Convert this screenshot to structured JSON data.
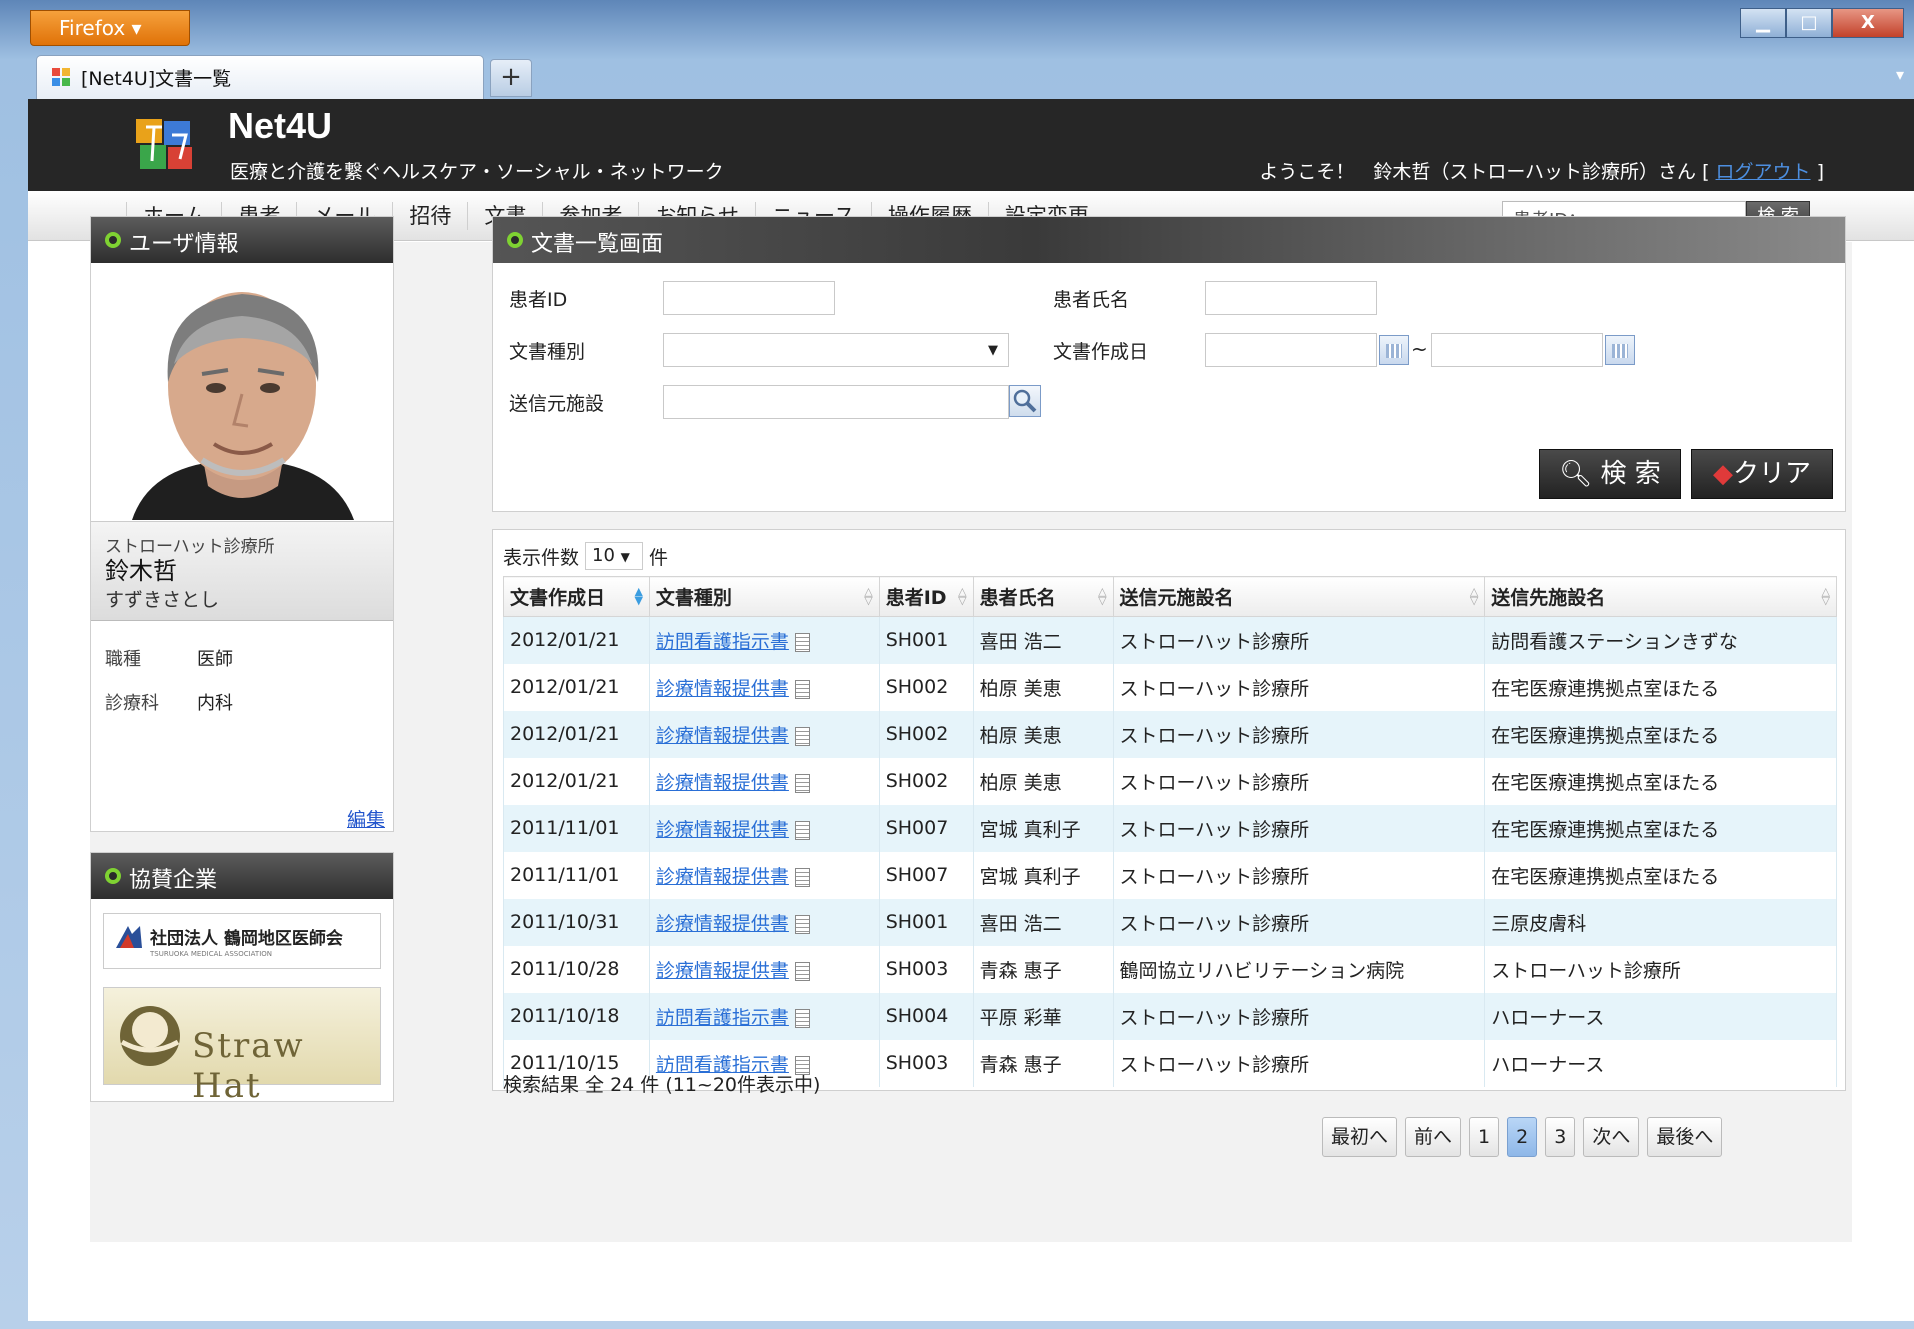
{
  "browser": {
    "menu_label": "Firefox ▾",
    "tab_title": "[Net4U]文書一覧",
    "new_tab": "+",
    "minimize": "▁",
    "maximize": "□",
    "close": "X",
    "tab_list": "▾"
  },
  "header": {
    "logo_name": "Net4U",
    "tagline": "医療と介護を繋ぐヘルスケア・ソーシャル・ネットワーク",
    "welcome_prefix": "ようこそ！　鈴木哲（ストローハット診療所）さん [ ",
    "logout": "ログアウト",
    "welcome_suffix": " ]"
  },
  "nav": {
    "items": [
      "ホーム",
      "患者",
      "メール",
      "招待",
      "文書",
      "参加者",
      "お知らせ",
      "ニュース",
      "操作履歴",
      "設定変更"
    ],
    "search_placeholder": "患者ID：",
    "search_button": "検 索"
  },
  "user_panel": {
    "title": "ユーザ情報",
    "org": "ストローハット診療所",
    "name": "鈴木哲",
    "kana": "すずきさとし",
    "attrs": [
      {
        "key": "職種",
        "value": "医師"
      },
      {
        "key": "診療科",
        "value": "内科"
      }
    ],
    "edit": "編集"
  },
  "sponsor_panel": {
    "title": "協賛企業",
    "sponsor1": "社団法人 鶴岡地区医師会",
    "sponsor1_sub": "TSURUOKA MEDICAL ASSOCIATION",
    "sponsor2": "Straw Hat"
  },
  "search_panel": {
    "title": "文書一覧画面",
    "patient_id_label": "患者ID",
    "patient_name_label": "患者氏名",
    "doc_type_label": "文書種別",
    "doc_date_label": "文書作成日",
    "date_sep": "~",
    "sender_label": "送信元施設",
    "search_button": "検 索",
    "clear_button": "クリア"
  },
  "results": {
    "page_size_label": "表示件数",
    "page_size_value": "10",
    "page_size_unit": "件",
    "columns": [
      "文書作成日",
      "文書種別",
      "患者ID",
      "患者氏名",
      "送信元施設名",
      "送信先施設名"
    ],
    "rows": [
      [
        "2012/01/21",
        "訪問看護指示書",
        "SH001",
        "喜田 浩二",
        "ストローハット診療所",
        "訪問看護ステーションきずな"
      ],
      [
        "2012/01/21",
        "診療情報提供書",
        "SH002",
        "柏原 美恵",
        "ストローハット診療所",
        "在宅医療連携拠点室ほたる"
      ],
      [
        "2012/01/21",
        "診療情報提供書",
        "SH002",
        "柏原 美恵",
        "ストローハット診療所",
        "在宅医療連携拠点室ほたる"
      ],
      [
        "2012/01/21",
        "診療情報提供書",
        "SH002",
        "柏原 美恵",
        "ストローハット診療所",
        "在宅医療連携拠点室ほたる"
      ],
      [
        "2011/11/01",
        "診療情報提供書",
        "SH007",
        "宮城 真利子",
        "ストローハット診療所",
        "在宅医療連携拠点室ほたる"
      ],
      [
        "2011/11/01",
        "診療情報提供書",
        "SH007",
        "宮城 真利子",
        "ストローハット診療所",
        "在宅医療連携拠点室ほたる"
      ],
      [
        "2011/10/31",
        "診療情報提供書",
        "SH001",
        "喜田 浩二",
        "ストローハット診療所",
        "三原皮膚科"
      ],
      [
        "2011/10/28",
        "診療情報提供書",
        "SH003",
        "青森 惠子",
        "鶴岡協立リハビリテーション病院",
        "ストローハット診療所"
      ],
      [
        "2011/10/18",
        "訪問看護指示書",
        "SH004",
        "平原 彩華",
        "ストローハット診療所",
        "ハローナース"
      ],
      [
        "2011/10/15",
        "訪問看護指示書",
        "SH003",
        "青森 惠子",
        "ストローハット診療所",
        "ハローナース"
      ]
    ],
    "summary": "検索結果 全 24 件 (11~20件表示中)"
  },
  "pager": {
    "first": "最初へ",
    "prev": "前へ",
    "pages": [
      "1",
      "2",
      "3"
    ],
    "current": "2",
    "next": "次へ",
    "last": "最後へ"
  },
  "colors": {
    "header_bg": "#262626",
    "row_alt": "#e6f4fa",
    "link": "#2a6fd6",
    "accent_green": "#7fd232"
  }
}
